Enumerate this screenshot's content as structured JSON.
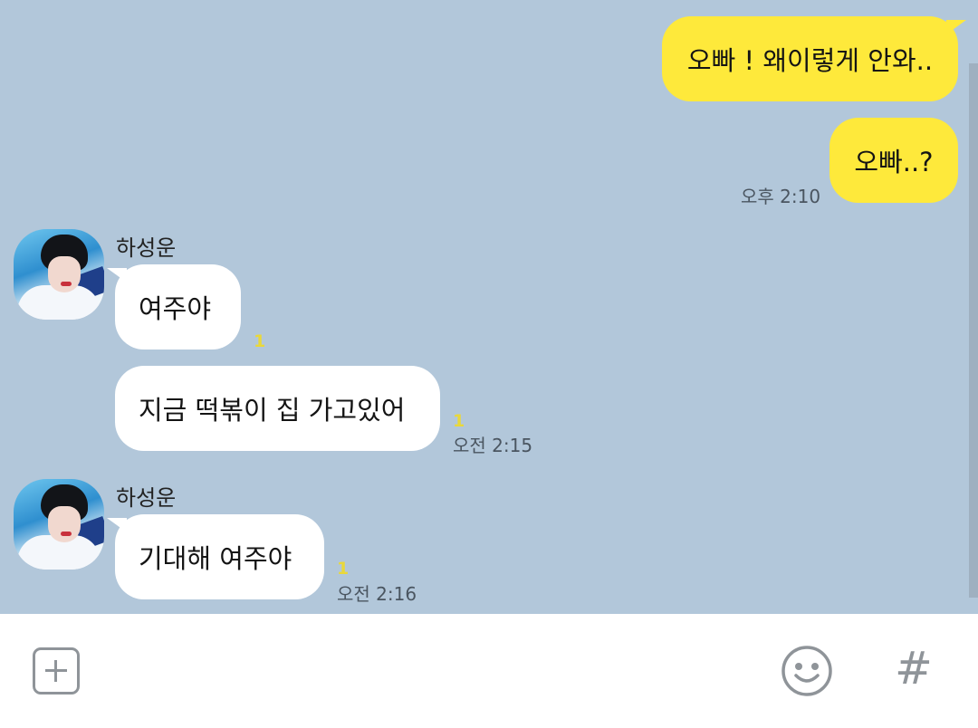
{
  "messages": {
    "mine": [
      {
        "text": "오빠 ! 왜이렇게 안와.."
      },
      {
        "text": "오빠..?"
      }
    ],
    "mine_time": "오후 2:10",
    "group1": {
      "sender": "하성운",
      "messages": [
        "여주야",
        "지금 떡볶이 집 가고있어"
      ],
      "unread": [
        "1",
        "1"
      ],
      "time": "오전 2:15"
    },
    "group2": {
      "sender": "하성운",
      "messages": [
        "기대해 여주야"
      ],
      "unread": [
        "1"
      ],
      "time": "오전 2:16"
    }
  },
  "input_bar": {
    "plus_icon": "plus-square-icon",
    "emoji_icon": "smiley-icon",
    "hash_label": "#"
  },
  "colors": {
    "chat_background": "#b2c7da",
    "my_bubble": "#fee93b",
    "their_bubble": "#ffffff",
    "unread_count": "#e9d83a"
  }
}
